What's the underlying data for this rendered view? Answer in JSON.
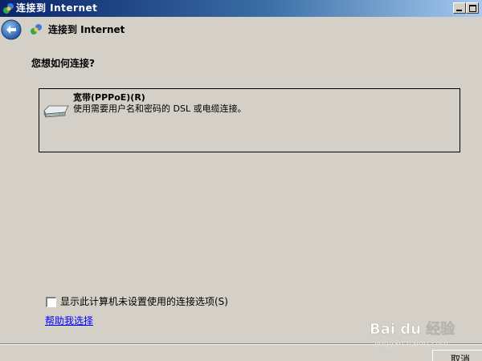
{
  "window": {
    "title": "连接到 Internet",
    "colors": {
      "titlebar_start": "#0a246a",
      "titlebar_end": "#a6caf0",
      "face": "#d4d0c8",
      "link": "#0000ff"
    },
    "controls": [
      "minimize-icon",
      "maximize-icon"
    ]
  },
  "header": {
    "back_icon": "back-arrow-icon",
    "icon": "network-globe-icon",
    "title": "连接到 Internet"
  },
  "main": {
    "question": "您想如何连接?",
    "options": [
      {
        "icon": "broadband-modem-icon",
        "title": "宽带(PPPoE)(R)",
        "description": "使用需要用户名和密码的 DSL 或电缆连接。"
      }
    ],
    "show_unconfigured_checkbox": {
      "label": "显示此计算机未设置使用的连接选项(S)",
      "checked": false
    },
    "help_link": "帮助我选择"
  },
  "footer": {
    "cancel_label": "取消"
  },
  "watermark": {
    "brand": "Bai du 经验",
    "url": "jingyan.baidu.com"
  }
}
